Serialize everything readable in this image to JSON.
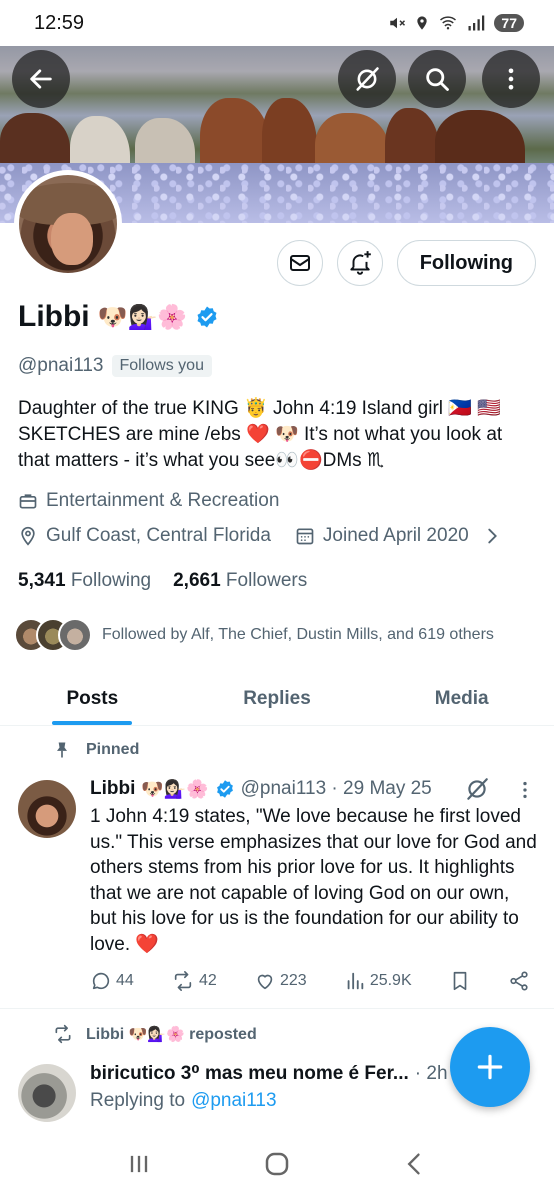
{
  "status": {
    "time": "12:59",
    "battery": "77"
  },
  "header": {
    "back": "back-arrow-icon",
    "grok": "grok-icon",
    "search": "search-icon",
    "more": "more-vertical-icon"
  },
  "profile": {
    "name": "Libbi",
    "name_emojis": "🐶💁🏻‍♀️🌸",
    "handle": "@pnai113",
    "follows_you": "Follows you",
    "bio": "Daughter of the true KING 🤴 John 4:19 Island girl 🇵🇭 🇺🇸 SKETCHES are mine /ebs ❤️ 🐶 It’s not what you look at that matters - it’s what you see👀⛔DMs ♏",
    "category": "Entertainment & Recreation",
    "location": "Gulf Coast, Central Florida",
    "joined": "Joined April 2020",
    "following_count": "5,341",
    "following_label": "Following",
    "followers_count": "2,661",
    "followers_label": "Followers",
    "followed_by": "Followed by Alf, The Chief, Dustin Mills, and 619 others"
  },
  "actions": {
    "follow_button": "Following"
  },
  "tabs": [
    {
      "label": "Posts"
    },
    {
      "label": "Replies"
    },
    {
      "label": "Media"
    }
  ],
  "posts": [
    {
      "pinned_label": "Pinned",
      "author": "Libbi",
      "emojis": "🐶💁🏻‍♀️🌸",
      "handle_date": "@pnai113 · 29 May 25",
      "text": "1 John 4:19 states, \"We love because he first loved us.\" This verse emphasizes that our love for God and others stems from his prior love for us. It highlights that we are not capable of loving God on our own, but his love for us is the foundation for our ability to love. ❤️",
      "replies": "44",
      "reposts": "42",
      "likes": "223",
      "views": "25.9K"
    },
    {
      "repost_label_name": "Libbi",
      "repost_emojis": "🐶💁🏻‍♀️🌸",
      "repost_label": "reposted",
      "author": "biricutico 3⁰ mas meu nome é Fer...",
      "time": "· 2h",
      "replying_prefix": "Replying to",
      "replying_to": "@pnai113"
    }
  ],
  "colors": {
    "accent": "#1d9bf0",
    "text": "#0f1419",
    "muted": "#536471",
    "like_heart": "#f91880"
  }
}
